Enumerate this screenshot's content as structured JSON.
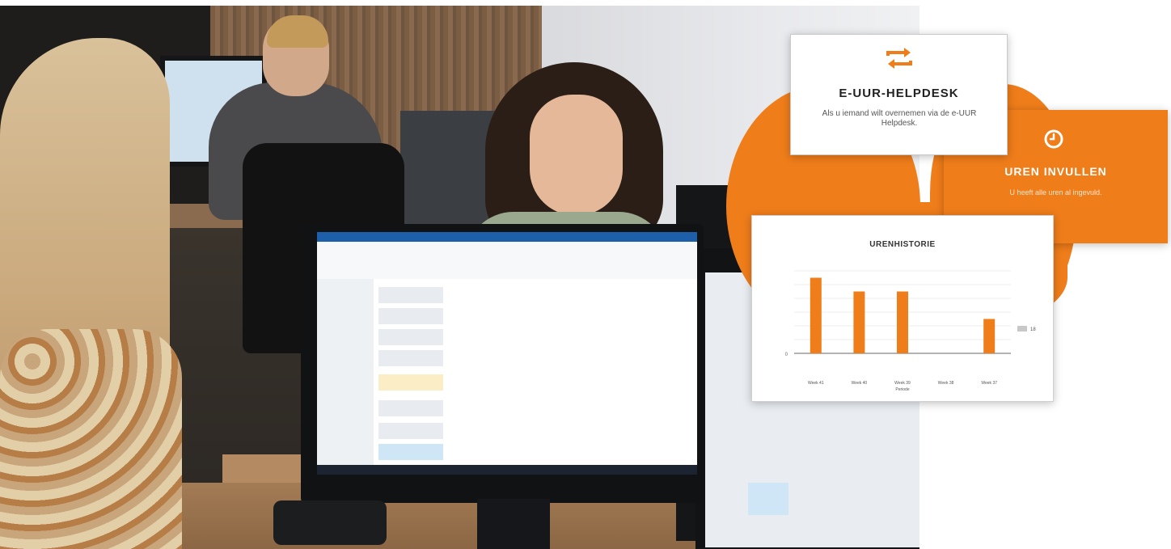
{
  "helpdesk_card": {
    "icon": "swap-arrows-icon",
    "title": "E-UUR-HELPDESK",
    "description": "Als u iemand wilt overnemen via de e-UUR Helpdesk."
  },
  "uren_card": {
    "icon": "clock-icon",
    "title": "UREN INVULLEN",
    "description": "U heeft alle uren al ingevuld."
  },
  "colors": {
    "accent": "#ef7d1a",
    "legend_grey": "#c8c8c8"
  },
  "chart_data": {
    "type": "bar",
    "title": "URENHISTORIE",
    "categories": [
      "Week 41",
      "Week 40",
      "Week 39",
      "Week 38",
      "Week 37"
    ],
    "values": [
      44,
      40,
      40,
      null,
      32
    ],
    "ylim": [
      22,
      46
    ],
    "y_ticks": [
      "0"
    ],
    "xlabel": "Periode",
    "legend": {
      "placement": "right",
      "entries": [
        "18"
      ]
    },
    "grid": true
  }
}
